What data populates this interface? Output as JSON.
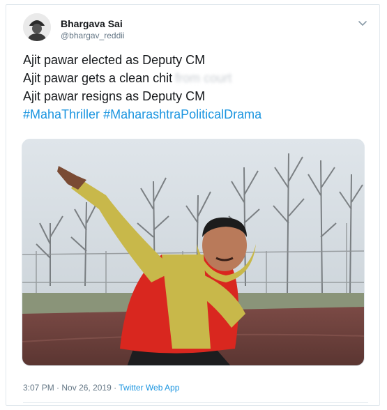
{
  "author": {
    "name": "Bhargava Sai",
    "handle": "@bhargav_reddii",
    "avatar_icon": "profile-avatar"
  },
  "tweet": {
    "lines": [
      "Ajit pawar elected as Deputy CM",
      "Ajit pawar gets a clean chit",
      "Ajit pawar resigns as Deputy CM"
    ],
    "blurred_text": "from court",
    "hashtags": [
      "#MahaThriller",
      "#MaharashtraPoliticalDrama"
    ]
  },
  "meta": {
    "time": "3:07 PM",
    "separator": "·",
    "date": "Nov 26, 2019",
    "source": "Twitter Web App"
  },
  "icons": {
    "menu": "chevron-down-icon"
  },
  "colors": {
    "link": "#1b95e0",
    "text": "#14171a",
    "muted": "#657786",
    "jacket": "#d9271f",
    "hoodie": "#c8b84a"
  }
}
